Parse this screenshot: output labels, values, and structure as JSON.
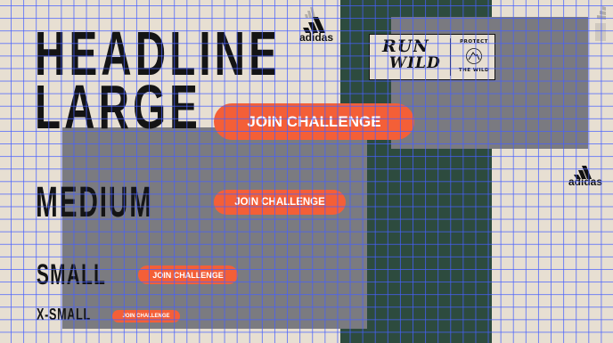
{
  "headlines": {
    "large_line1": "HEADLINE",
    "large_line2": "LARGE",
    "medium": "MEDIUM",
    "small": "SMALL",
    "xsmall": "X-SMALL"
  },
  "cta": {
    "large": "JOIN CHALLENGE",
    "medium": "JOIN CHALLENGE",
    "small": "JOIN CHALLENGE",
    "xsmall": "JOIN CHALLENGE"
  },
  "brand": {
    "logo_text": "adidas",
    "logo_icon": "adidas-three-bars-icon"
  },
  "badge": {
    "line1": "RUN",
    "line2": "WILD",
    "seal_top": "PROTECT",
    "seal_bottom": "THE WILD",
    "seal_icon": "mountain-icon"
  },
  "colors": {
    "background": "#e7dfd2",
    "forest_green": "#2d4b3e",
    "overlay_gray": "#7b7b80",
    "cta_orange": "#f45f37",
    "grid_blue": "#465fff",
    "ink": "#141414"
  }
}
